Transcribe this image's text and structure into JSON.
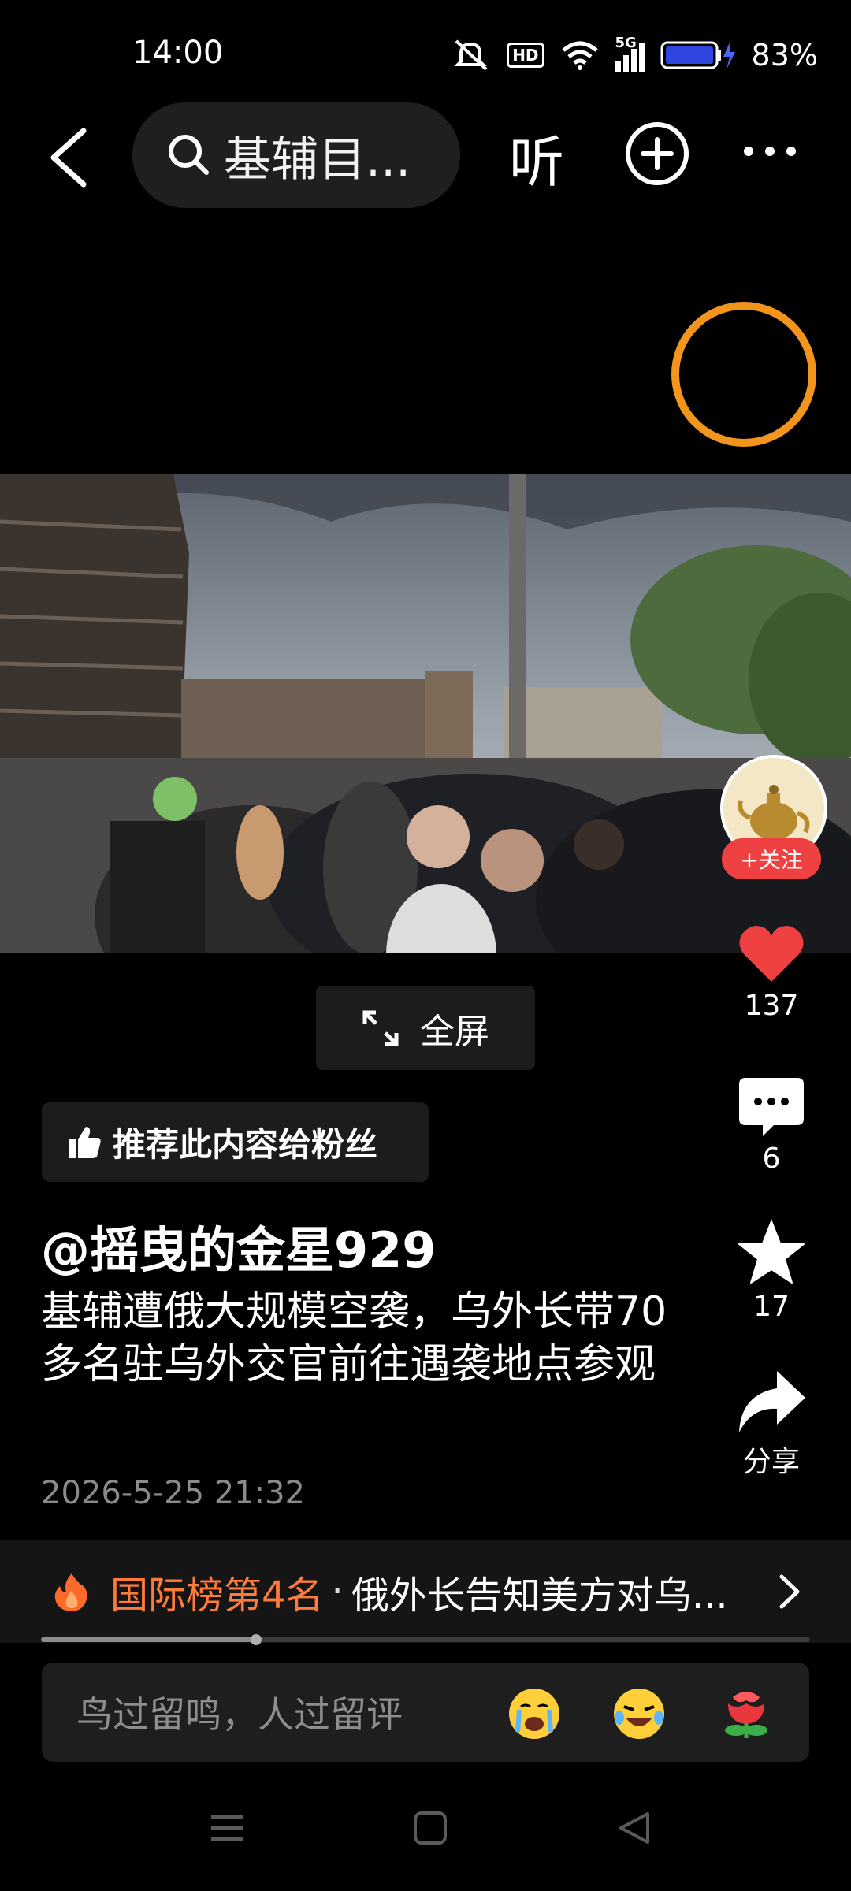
{
  "status_bar": {
    "time": "14:00",
    "hd_label": "HD",
    "network": "5G",
    "battery_percent": "83%"
  },
  "top_bar": {
    "search_text": "基辅目...",
    "listen_label": "听"
  },
  "video": {
    "fullscreen_label": "全屏"
  },
  "author_badge": {
    "follow_label": "+关注"
  },
  "actions": {
    "likes": "137",
    "comments": "6",
    "favorites": "17",
    "share_label": "分享"
  },
  "post": {
    "recommend_label": "推荐此内容给粉丝",
    "author": "@摇曳的金星929",
    "description": "基辅遭俄大规模空袭，乌外长带70多名驻乌外交官前往遇袭地点参观",
    "timestamp": "2026-5-25 21:32"
  },
  "trending": {
    "rank_label": "国际榜第4名",
    "separator": "·",
    "headline": "俄外长告知美方对乌..."
  },
  "progress": {
    "played_fraction": 0.28
  },
  "comment_box": {
    "placeholder": "鸟过留鸣，人过留评"
  },
  "colors": {
    "accent_orange": "#f3951c",
    "like_red": "#f04142",
    "trend_orange": "#ff7b3b",
    "background": "#000000"
  },
  "icons": [
    "mute-icon",
    "wifi-icon",
    "signal-icon",
    "battery-icon",
    "back-icon",
    "search-icon",
    "add-icon",
    "more-icon",
    "heart-icon",
    "comment-icon",
    "star-icon",
    "share-icon",
    "thumbs-up-icon",
    "expand-icon",
    "fire-icon",
    "chevron-right-icon",
    "crying-emoji",
    "laughing-emoji",
    "rose-emoji"
  ]
}
